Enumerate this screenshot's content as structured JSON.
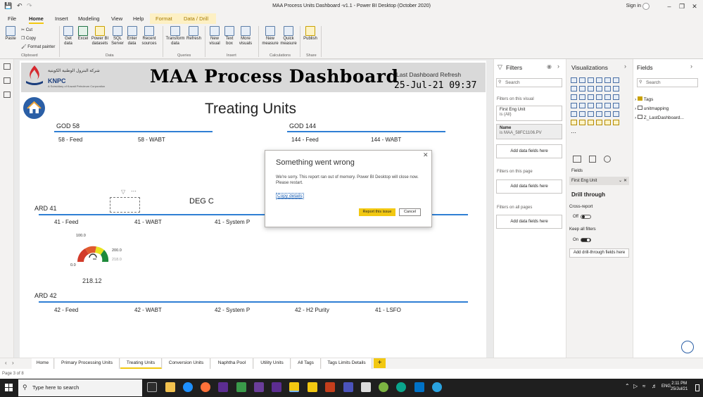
{
  "window": {
    "title": "MAA Process Units Dashboard -v1.1 - Power BI Desktop (October 2020)",
    "sign_in": "Sign in"
  },
  "ribbon_tabs": [
    "File",
    "Home",
    "Insert",
    "Modeling",
    "View",
    "Help",
    "Format",
    "Data / Drill"
  ],
  "clipboard": {
    "paste": "Paste",
    "cut": "Cut",
    "copy": "Copy",
    "format_painter": "Format painter",
    "group": "Clipboard"
  },
  "data_group": {
    "buttons": [
      "Get data",
      "Excel",
      "Power BI datasets",
      "SQL Server",
      "Enter data",
      "Recent sources"
    ],
    "group": "Data"
  },
  "queries_group": {
    "buttons": [
      "Transform data",
      "Refresh"
    ],
    "group": "Queries"
  },
  "insert_group": {
    "buttons": [
      "New visual",
      "Text box",
      "More visuals"
    ],
    "group": "Insert"
  },
  "calc_group": {
    "buttons": [
      "New measure",
      "Quick measure"
    ],
    "group": "Calculations"
  },
  "share_group": {
    "buttons": [
      "Publish"
    ],
    "group": "Share"
  },
  "report": {
    "org_arabic": "شركة البترول الوطنية الكويتية",
    "org_brand": "KNPC",
    "org_sub": "A Subsidiary of Kuwait Petroleum Corporation",
    "dashboard_title": "MAA Process Dashboard",
    "last_refresh_label": "Last Dashboard Refresh",
    "last_refresh_value": "25-Jul-21 09:37",
    "page_heading": "Treating Units",
    "sections": {
      "god58": {
        "title": "GOD 58",
        "fields": [
          "58 - Feed",
          "58 - WABT"
        ]
      },
      "god144": {
        "title": "GOD 144",
        "fields": [
          "144 - Feed",
          "144 - WABT"
        ]
      },
      "ard41": {
        "title": "ARD 41",
        "fields": [
          "41 - Feed",
          "41 - WABT",
          "41 - System P"
        ]
      },
      "degc": {
        "title": "DEG C"
      },
      "ard42": {
        "title": "ARD 42",
        "fields": [
          "42 - Feed",
          "42 - WABT",
          "42 - System P",
          "42 - H2 Purity",
          "41 - LSFO"
        ]
      }
    },
    "gauge": {
      "min": "0.0",
      "max": "200.0",
      "top": "100.0",
      "target": "218.0",
      "value": "218.12",
      "fraction": 1.0
    }
  },
  "dialog": {
    "title": "Something went wrong",
    "message": "We're sorry. This report ran out of memory. Power BI Desktop will close now. Please restart.",
    "copy_details": "Copy details",
    "report_button": "Report this issue",
    "cancel_button": "Cancel"
  },
  "filters_pane": {
    "title": "Filters",
    "search_placeholder": "Search",
    "on_visual": "Filters on this visual",
    "card1_name": "First Eng Unit",
    "card1_value": "is (All)",
    "card2_name": "Name",
    "card2_value": "is MAA_58FC1106.PV",
    "add_fields": "Add data fields here",
    "on_page": "Filters on this page",
    "on_all_pages": "Filters on all pages"
  },
  "viz_pane": {
    "title": "Visualizations",
    "fields_label": "Fields",
    "field_value": "First Eng Unit",
    "drill_through": "Drill through",
    "cross_report": "Cross-report",
    "off": "Off",
    "keep_filters": "Keep all filters",
    "on": "On",
    "add_drill": "Add drill-through fields here"
  },
  "fields_pane": {
    "title": "Fields",
    "search_placeholder": "Search",
    "tables": [
      "Tags",
      "unitmapping",
      "Z_LastDashboard..."
    ]
  },
  "page_tabs": [
    "Home",
    "Primary Processing Units",
    "Treating Units",
    "Conversion Units",
    "Naphtha Pool",
    "Utility Units",
    "All Tags",
    "Tags Limits Details"
  ],
  "active_page": "Treating Units",
  "status_bar": "Page 3 of 8",
  "taskbar": {
    "search_placeholder": "Type here to search",
    "lang": "ENG",
    "time": "2:11 PM",
    "date": "25/Jul/21"
  }
}
